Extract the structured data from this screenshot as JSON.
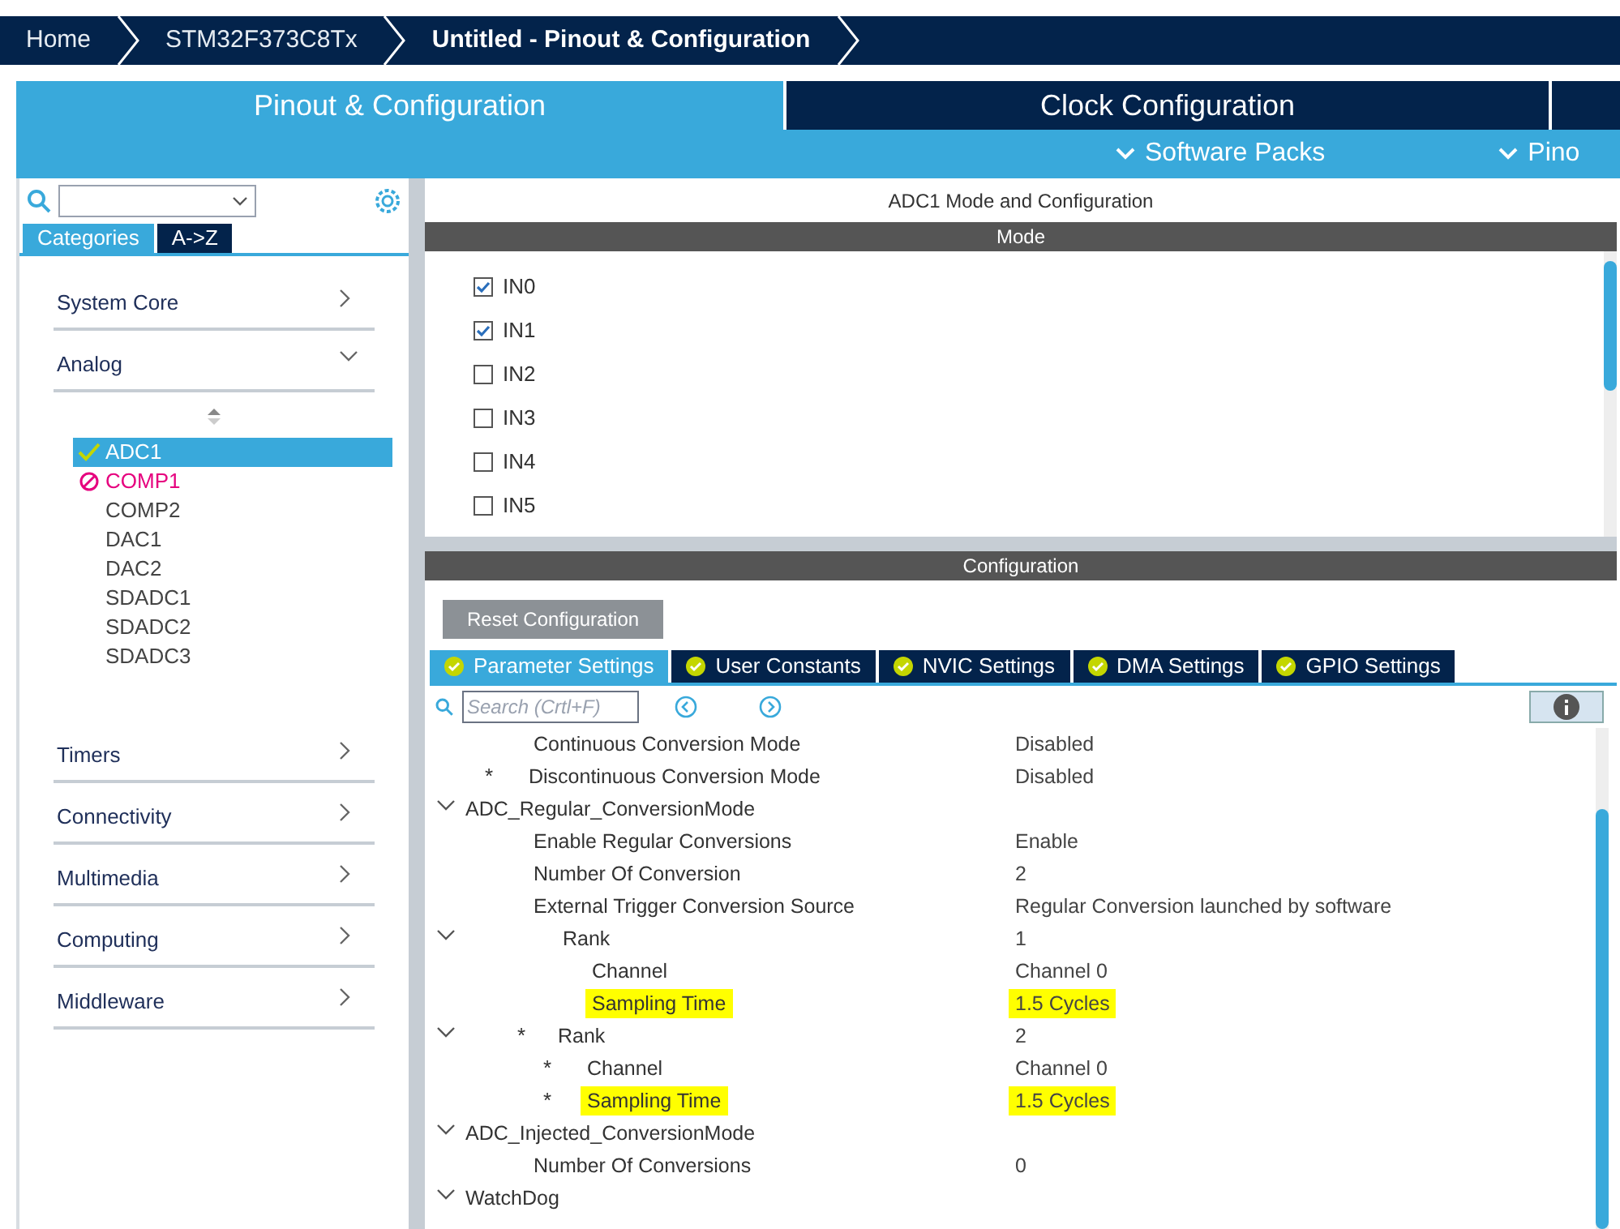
{
  "breadcrumbs": [
    {
      "label": "Home",
      "current": false
    },
    {
      "label": "STM32F373C8Tx",
      "current": false
    },
    {
      "label": "Untitled - Pinout & Configuration",
      "current": true
    }
  ],
  "main_tabs": [
    {
      "label": "Pinout & Configuration",
      "selected": true
    },
    {
      "label": "Clock Configuration",
      "selected": false
    }
  ],
  "sub_menus": [
    "Software Packs",
    "Pino"
  ],
  "sidebar": {
    "view_tabs": [
      {
        "label": "Categories",
        "selected": true
      },
      {
        "label": "A->Z",
        "selected": false
      }
    ],
    "categories": [
      {
        "label": "System Core",
        "expanded": false
      },
      {
        "label": "Analog",
        "expanded": true,
        "children": [
          {
            "label": "ADC1",
            "kind": "ok",
            "selected": true
          },
          {
            "label": "COMP1",
            "kind": "blocked",
            "selected": false
          },
          {
            "label": "COMP2",
            "kind": "plain",
            "selected": false
          },
          {
            "label": "DAC1",
            "kind": "plain",
            "selected": false
          },
          {
            "label": "DAC2",
            "kind": "plain",
            "selected": false
          },
          {
            "label": "SDADC1",
            "kind": "plain",
            "selected": false
          },
          {
            "label": "SDADC2",
            "kind": "plain",
            "selected": false
          },
          {
            "label": "SDADC3",
            "kind": "plain",
            "selected": false
          }
        ]
      },
      {
        "label": "Timers",
        "expanded": false
      },
      {
        "label": "Connectivity",
        "expanded": false
      },
      {
        "label": "Multimedia",
        "expanded": false
      },
      {
        "label": "Computing",
        "expanded": false
      },
      {
        "label": "Middleware",
        "expanded": false
      }
    ]
  },
  "panel_title": "ADC1 Mode and Configuration",
  "mode": {
    "header": "Mode",
    "channels": [
      {
        "label": "IN0",
        "checked": true
      },
      {
        "label": "IN1",
        "checked": true
      },
      {
        "label": "IN2",
        "checked": false
      },
      {
        "label": "IN3",
        "checked": false
      },
      {
        "label": "IN4",
        "checked": false
      },
      {
        "label": "IN5",
        "checked": false
      }
    ]
  },
  "configuration": {
    "header": "Configuration",
    "reset_button": "Reset Configuration",
    "tabs": [
      {
        "label": "Parameter Settings",
        "selected": true
      },
      {
        "label": "User Constants",
        "selected": false
      },
      {
        "label": "NVIC Settings",
        "selected": false
      },
      {
        "label": "DMA Settings",
        "selected": false
      },
      {
        "label": "GPIO Settings",
        "selected": false
      }
    ],
    "search": {
      "placeholder": "Search (Crtl+F)"
    },
    "parameters": [
      {
        "label": "Continuous Conversion Mode",
        "value": "Disabled",
        "highlighted": false
      },
      {
        "marker": "*",
        "label": "Discontinuous Conversion Mode",
        "value": "Disabled",
        "highlighted": false
      },
      {
        "label": "ADC_Regular_ConversionMode",
        "expanded": true,
        "children": [
          {
            "label": "Enable Regular Conversions",
            "value": "Enable",
            "highlighted": false
          },
          {
            "label": "Number Of Conversion",
            "value": "2",
            "highlighted": false
          },
          {
            "label": "External Trigger Conversion Source",
            "value": "Regular Conversion launched by software",
            "highlighted": false
          },
          {
            "label": "Rank",
            "value": "1",
            "expanded": true,
            "children": [
              {
                "label": "Channel",
                "value": "Channel 0",
                "highlighted": false
              },
              {
                "label": "Sampling Time",
                "value": "1.5 Cycles",
                "highlighted": true
              }
            ]
          },
          {
            "marker": "*",
            "label": "Rank",
            "value": "2",
            "expanded": true,
            "children": [
              {
                "marker": "*",
                "label": "Channel",
                "value": "Channel 0",
                "highlighted": false
              },
              {
                "marker": "*",
                "label": "Sampling Time",
                "value": "1.5 Cycles",
                "highlighted": true
              }
            ]
          }
        ]
      },
      {
        "label": "ADC_Injected_ConversionMode",
        "expanded": true,
        "children": [
          {
            "label": "Number Of Conversions",
            "value": "0",
            "highlighted": false
          }
        ]
      },
      {
        "label": "WatchDog",
        "expanded": true
      }
    ]
  }
}
